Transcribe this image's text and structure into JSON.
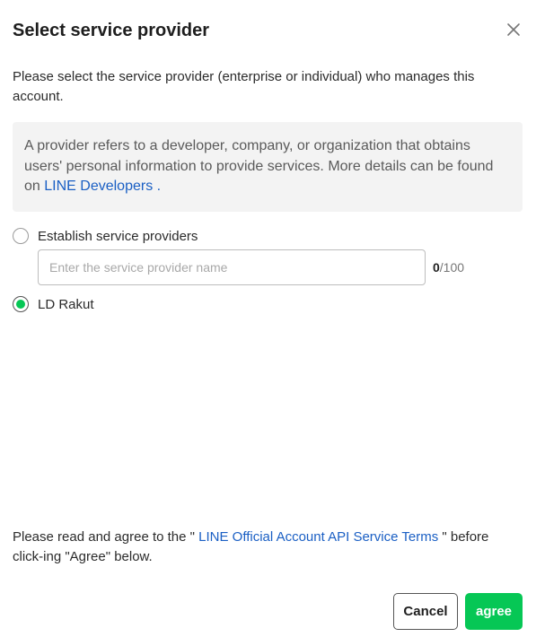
{
  "dialog": {
    "title": "Select service provider",
    "close_icon": "close-icon",
    "description": "Please select the service provider (enterprise or individual) who manages this account.",
    "info": {
      "text_before": "A provider refers to a developer, company, or organization that obtains users' personal information to provide services. More details can be found on ",
      "link_text": "LINE Developers",
      "text_after": " ."
    },
    "options": [
      {
        "label": "Establish service providers",
        "selected": false
      },
      {
        "label": "LD Rakut",
        "selected": true
      }
    ],
    "name_input": {
      "placeholder": "Enter the service provider name",
      "value": "",
      "count_current": "0",
      "count_max": "/100"
    },
    "terms": {
      "before": "Please read and agree to the \" ",
      "link_text": "LINE Official Account API Service Terms",
      "after": " \" before click-ing \"Agree\" below."
    },
    "buttons": {
      "cancel": "Cancel",
      "agree": "agree"
    },
    "colors": {
      "accent_green": "#06c755",
      "link_blue": "#1a5fc4",
      "info_bg": "#f3f3f3"
    }
  }
}
